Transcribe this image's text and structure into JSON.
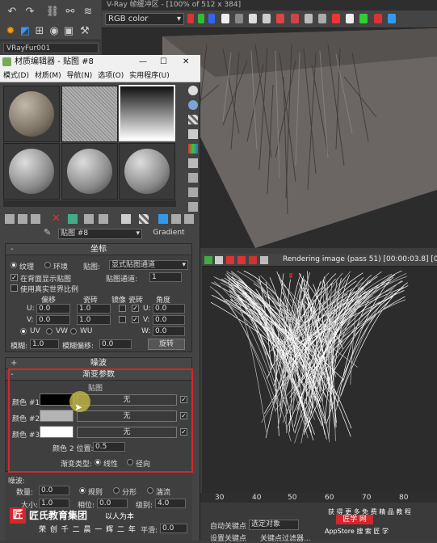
{
  "vfb": {
    "title": "V-Ray 帧缓冲区 - [100% of 512 x 384]",
    "channel": "RGB color",
    "render_status": "Rendering image (pass 51) [00:00:03.8] [0h"
  },
  "scene": {
    "object_name": "VRayFur001"
  },
  "material_editor": {
    "title": "材质编辑器 - 贴图 #8",
    "menu": [
      "模式(D)",
      "材质(M)",
      "导航(N)",
      "选项(O)",
      "实用程序(U)"
    ],
    "map_name": "贴图 #8",
    "map_type": "Gradient"
  },
  "coordinates": {
    "header": "坐标",
    "texture_label": "纹理",
    "environ_label": "环境",
    "mapping_label": "贴图:",
    "mapping_value": "显式贴图通道",
    "show_in_viewport": "在背面显示贴图",
    "map_channel_label": "贴图通道:",
    "map_channel_value": "1",
    "real_world": "使用真实世界比例",
    "offset": "偏移",
    "tiling": "瓷砖",
    "mirror": "镜像",
    "tile": "瓷砖",
    "angle": "角度",
    "u_label": "U:",
    "v_label": "V:",
    "w_label": "W:",
    "u_offset": "0.0",
    "v_offset": "0.0",
    "u_tiling": "1.0",
    "v_tiling": "1.0",
    "u_angle": "0.0",
    "v_angle": "0.0",
    "w_angle": "0.0",
    "uv": "UV",
    "vw": "VW",
    "wu": "WU",
    "blur_label": "模糊:",
    "blur_value": "1.0",
    "blur_offset_label": "模糊偏移:",
    "blur_offset_value": "0.0",
    "rotate": "旋转"
  },
  "noise_rollup": {
    "header": "噪波"
  },
  "gradient_params": {
    "header": "渐变参数",
    "maps_label": "贴图",
    "color1_label": "颜色 #1",
    "color2_label": "颜色 #2",
    "color3_label": "颜色 #3",
    "color1": "#000000",
    "color2": "#b4b4b4",
    "color3": "#ffffff",
    "none": "无",
    "color2_pos_label": "颜色 2 位置:",
    "color2_pos_value": "0.5",
    "type_label": "渐变类型:",
    "type_linear": "线性",
    "type_radial": "径向"
  },
  "noise": {
    "header": "噪波:",
    "amount_label": "数量:",
    "amount_value": "0.0",
    "regular": "规则",
    "fractal": "分形",
    "turbulence": "湍流",
    "size_label": "大小:",
    "size_value": "1.0",
    "phase_label": "相位:",
    "phase_value": "0.0",
    "levels_label": "级别:",
    "levels_value": "4.0",
    "smooth_label": "平滑:",
    "smooth_value": "0.0"
  },
  "timeline": {
    "ticks": [
      "30",
      "40",
      "50",
      "60",
      "70",
      "80"
    ],
    "autokey": "自动关键点",
    "selected": "选定对象",
    "set_key": "设置关键点",
    "key_filter": "关键点过滤器..."
  },
  "watermark": {
    "company": "匠氏教育集团",
    "slogan": "以人为本",
    "subtitle": "荣 创 千 二 晨 一 辉 二 年",
    "promo": "获 得 更 多 免 费 精 品 教 程",
    "app": "AppStore 搜 索 匠 学 ",
    "brand": "匠学 网"
  },
  "colors": {
    "highlight_border": "#d6252c"
  }
}
